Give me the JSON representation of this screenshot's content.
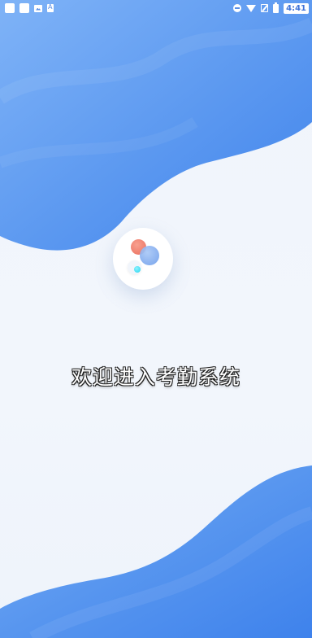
{
  "status_bar": {
    "time": "4:41",
    "left_icons": [
      "app-square-icon",
      "app-square-icon",
      "gallery-icon",
      "text-a-icon"
    ],
    "right_icons": [
      "do-not-disturb-icon",
      "wifi-icon",
      "no-signal-icon",
      "battery-icon"
    ]
  },
  "splash": {
    "welcome_text": "欢迎进入考勤系统",
    "logo_icon": "app-logo-icon"
  },
  "colors": {
    "wave_blue": "#4c8ff0",
    "wave_blue_light": "#6aa6f5",
    "background": "#f1f5fc",
    "logo_red": "#ea6d5c",
    "logo_blue": "#6c9cea",
    "logo_cyan": "#22d4ee"
  }
}
